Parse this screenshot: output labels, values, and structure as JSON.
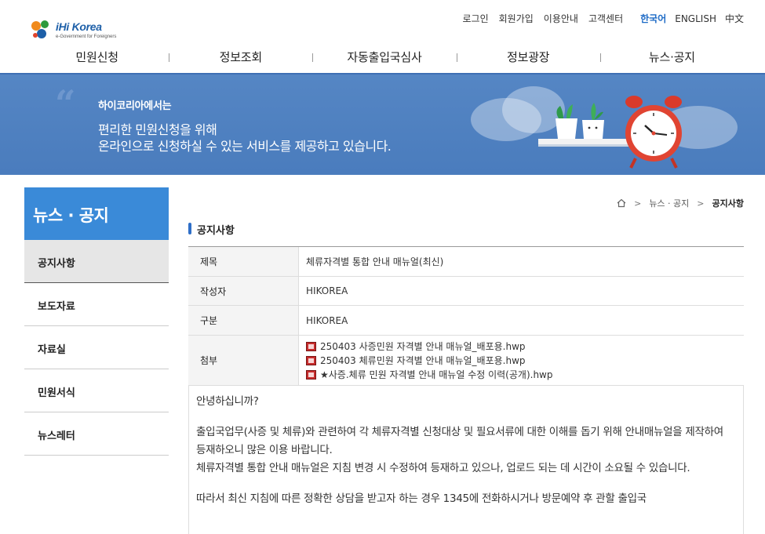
{
  "logo": {
    "word": "iHi Korea",
    "sub": "e-Government for Foreigners"
  },
  "util_links": [
    "로그인",
    "회원가입",
    "이용안내",
    "고객센터"
  ],
  "languages": [
    {
      "label": "한국어",
      "active": true
    },
    {
      "label": "ENGLISH"
    },
    {
      "label": "中文"
    }
  ],
  "gnb": [
    "민원신청",
    "정보조회",
    "자동출입국심사",
    "정보광장",
    "뉴스·공지"
  ],
  "banner": {
    "eyebrow": "하이코리아에서는",
    "line1": "편리한 민원신청을 위해",
    "line2": "온라인으로 신청하실 수 있는 서비스를 제공하고 있습니다."
  },
  "side": {
    "title": "뉴스 · 공지",
    "items": [
      "공지사항",
      "보도자료",
      "자료실",
      "민원서식",
      "뉴스레터"
    ]
  },
  "breadcrumb": {
    "section": "뉴스 · 공지",
    "current": "공지사항"
  },
  "page_title": "공지사항",
  "detail": {
    "title_label": "제목",
    "title_value": "체류자격별 통합 안내 매뉴얼(최신)",
    "author_label": "작성자",
    "author_value": "HIKOREA",
    "category_label": "구분",
    "category_value": "HIKOREA",
    "attach_label": "첨부",
    "files": [
      "250403 사증민원 자격별 안내 매뉴얼_배포용.hwp",
      "250403 체류민원 자격별 안내 매뉴얼_배포용.hwp",
      "★사증.체류 민원 자격별 안내 매뉴얼 수정 이력(공개).hwp"
    ]
  },
  "body": {
    "greeting": "안녕하십니까?",
    "p1": "출입국업무(사증 및 체류)와 관련하여 각 체류자격별 신청대상 및 필요서류에 대한 이해를 돕기 위해 안내매뉴얼을 제작하여 등재하오니 많은 이용 바랍니다.",
    "p2": "체류자격별 통합 안내 매뉴얼은 지침 변경 시 수정하여 등재하고 있으나, 업로드 되는 데 시간이 소요될 수 있습니다.",
    "p3": "따라서 최신 지침에 따른 정확한 상담을 받고자 하는 경우 1345에 전화하시거나 방문예약 후 관할 출입국"
  },
  "colors": {
    "accent": "#3a8ad8",
    "banner": "#4a7cbd",
    "lang_active": "#1e6bc6"
  }
}
